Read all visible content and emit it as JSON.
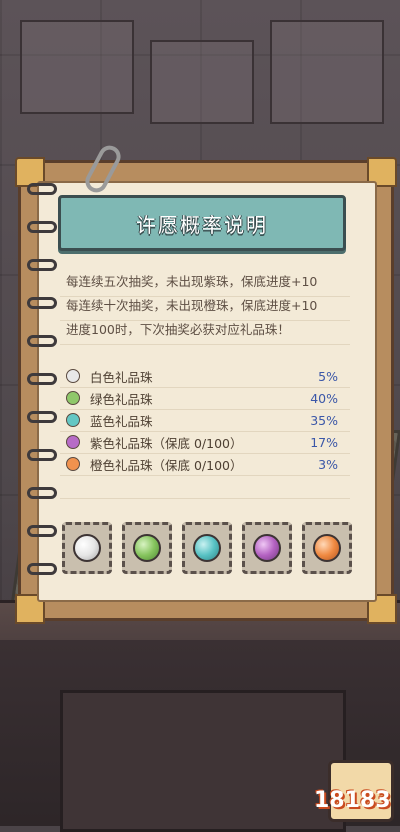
{
  "title": "许愿概率说明",
  "rules": [
    "每连续五次抽奖，未出现紫珠，保底进度+10",
    "每连续十次抽奖，未出现橙珠，保底进度+10",
    "进度100时，下次抽奖必获对应礼品珠！"
  ],
  "probabilities": [
    {
      "label": "白色礼品珠",
      "percent": "5%",
      "color": "#e8e8e8"
    },
    {
      "label": "绿色礼品珠",
      "percent": "40%",
      "color": "#8fc86a"
    },
    {
      "label": "蓝色礼品珠",
      "percent": "35%",
      "color": "#64c7c4"
    },
    {
      "label": "紫色礼品珠（保底 0/100）",
      "percent": "17%",
      "color": "#b76bc6"
    },
    {
      "label": "橙色礼品珠（保底 0/100）",
      "percent": "3%",
      "color": "#f0924e"
    }
  ],
  "orb_slots": [
    {
      "name": "white",
      "color": "#e6e6e6"
    },
    {
      "name": "green",
      "color": "#86c45e"
    },
    {
      "name": "teal",
      "color": "#58c2c4"
    },
    {
      "name": "purple",
      "color": "#b462c2"
    },
    {
      "name": "orange",
      "color": "#f08a42"
    }
  ],
  "watermark": "18183",
  "colors": {
    "banner": "#7fb8b4",
    "percent_text": "#3b57a8",
    "paper": "#f3ead7"
  }
}
